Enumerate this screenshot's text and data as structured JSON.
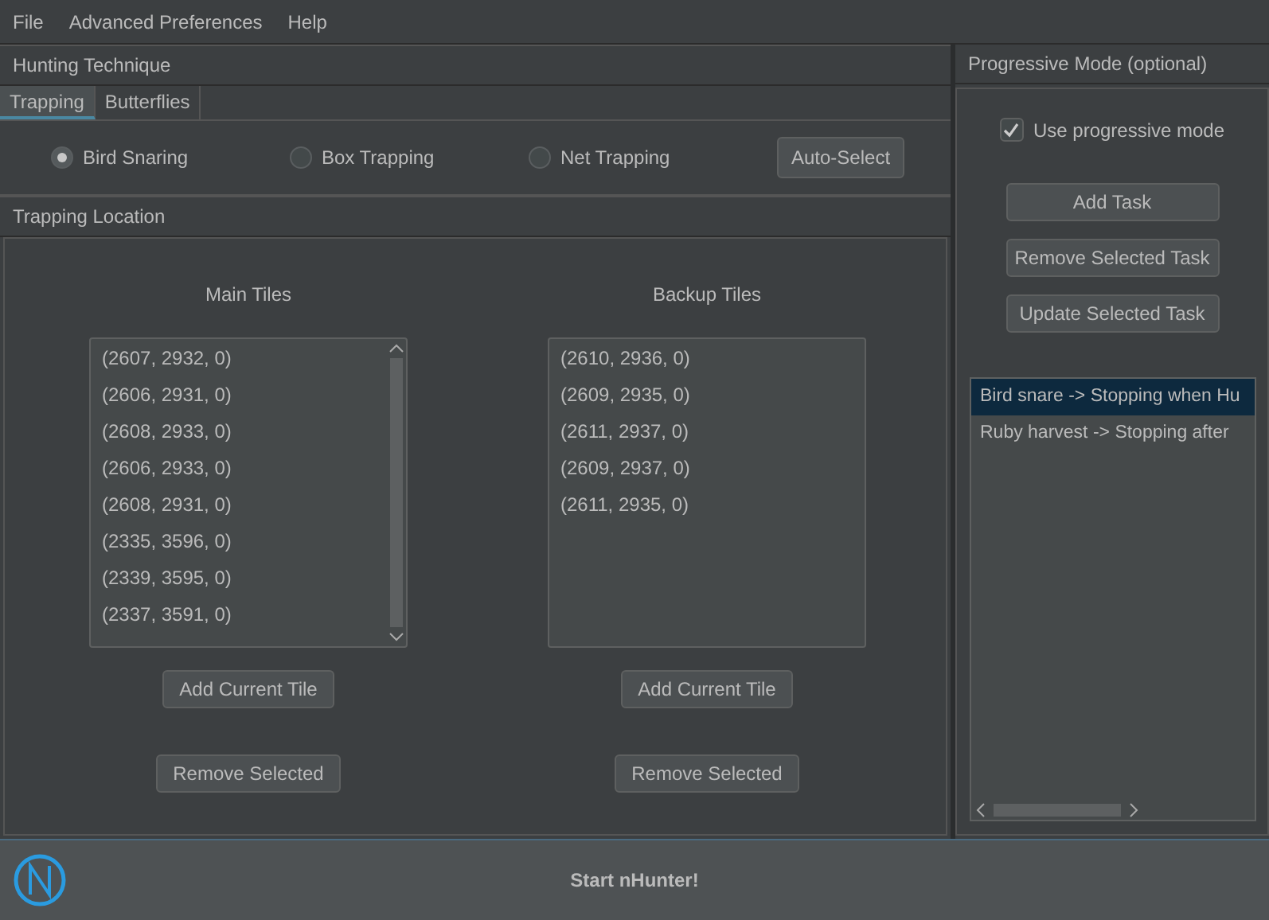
{
  "menu": [
    "File",
    "Advanced Preferences",
    "Help"
  ],
  "hunting": {
    "title": "Hunting Technique",
    "tabs": [
      {
        "label": "Trapping",
        "selected": true
      },
      {
        "label": "Butterflies",
        "selected": false
      }
    ],
    "methods": [
      {
        "label": "Bird Snaring",
        "selected": true
      },
      {
        "label": "Box Trapping",
        "selected": false
      },
      {
        "label": "Net Trapping",
        "selected": false
      }
    ],
    "auto_select": "Auto-Select"
  },
  "location": {
    "title": "Trapping Location",
    "lists": [
      {
        "title": "Main Tiles",
        "scrollable": true,
        "tiles": [
          "(2607, 2932, 0)",
          "(2606, 2931, 0)",
          "(2608, 2933, 0)",
          "(2606, 2933, 0)",
          "(2608, 2931, 0)",
          "(2335, 3596, 0)",
          "(2339, 3595, 0)",
          "(2337, 3591, 0)"
        ],
        "add": "Add Current Tile",
        "remove": "Remove Selected"
      },
      {
        "title": "Backup Tiles",
        "scrollable": false,
        "tiles": [
          "(2610, 2936, 0)",
          "(2609, 2935, 0)",
          "(2611, 2937, 0)",
          "(2609, 2937, 0)",
          "(2611, 2935, 0)"
        ],
        "add": "Add Current Tile",
        "remove": "Remove Selected"
      }
    ]
  },
  "progressive": {
    "title": "Progressive Mode (optional)",
    "checkbox": {
      "label": "Use progressive mode",
      "checked": true
    },
    "buttons": [
      "Add Task",
      "Remove Selected Task",
      "Update Selected Task"
    ],
    "tasks": [
      {
        "label": "Bird snare -> Stopping when Hu",
        "selected": true
      },
      {
        "label": "Ruby harvest -> Stopping after",
        "selected": false
      }
    ]
  },
  "start_button": "Start nHunter!"
}
